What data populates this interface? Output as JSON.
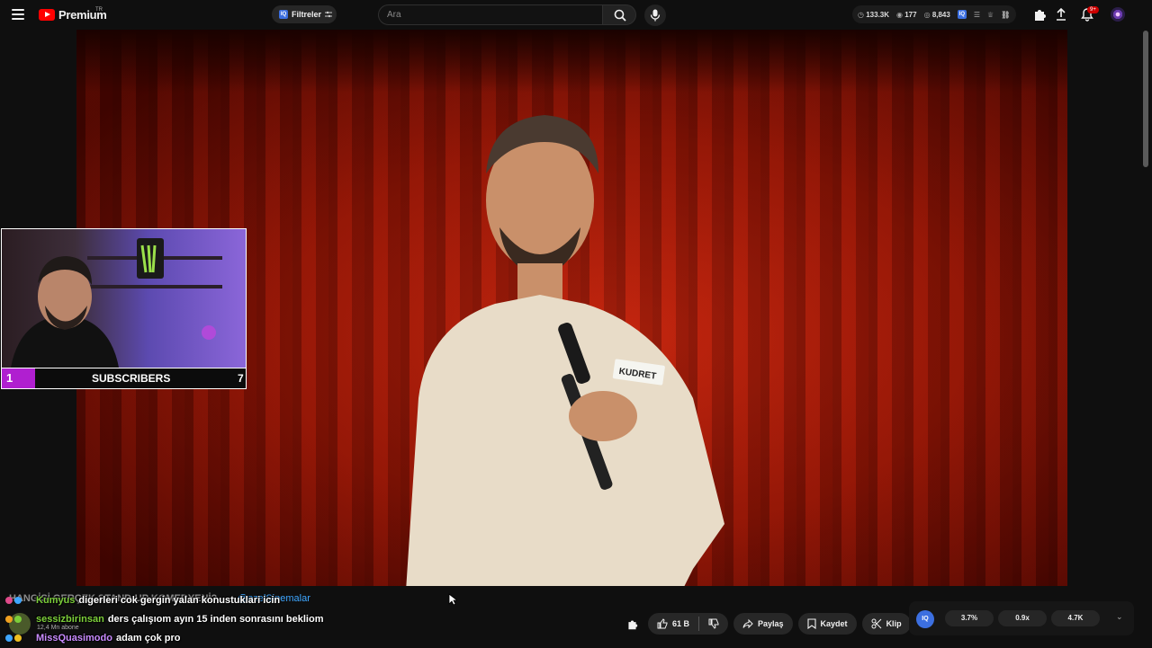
{
  "topbar": {
    "logo_text": "Premium",
    "region": "TR",
    "filters_label": "Filtreler",
    "search_placeholder": "Ara",
    "stats": {
      "views": "133.3K",
      "comments": "177",
      "third": "8,843"
    },
    "notification_badge": "9+"
  },
  "overlay": {
    "subscribers_label": "SUBSCRIBERS",
    "count_left": "1",
    "count_right": "7"
  },
  "video_info": {
    "title": "HANGİSİ GERÇEK STAND-UP KOMEDYENİ?",
    "channel": "@ozelSinemalar",
    "channel_subs": "12,4 Mn abone"
  },
  "chat": [
    {
      "user": "Kumyus",
      "message": "digerleri cok gergin yalan konustuklari icin",
      "user_color": "#7ccf3a"
    },
    {
      "user": "sessizbirinsan",
      "message": "ders çalışıom ayın 15 inden sonrasını bekliom",
      "user_color": "#7ccf3a"
    },
    {
      "user": "MissQuasimodo",
      "message": "adam çok pro",
      "user_color": "#c98bff"
    }
  ],
  "actions": {
    "like_count": "61 B",
    "share_label": "Paylaş",
    "save_label": "Kaydet",
    "clip_label": "Klip"
  },
  "iq_panel": {
    "logo": "IQ",
    "stat1": "3.7%",
    "stat2": "0.9x",
    "stat3": "4.7K"
  },
  "video_caption_tag": "KUDRET",
  "colors": {
    "accent_red": "#ff0000",
    "link_blue": "#3ea6ff",
    "overlay_purple": "#b01fd0"
  }
}
